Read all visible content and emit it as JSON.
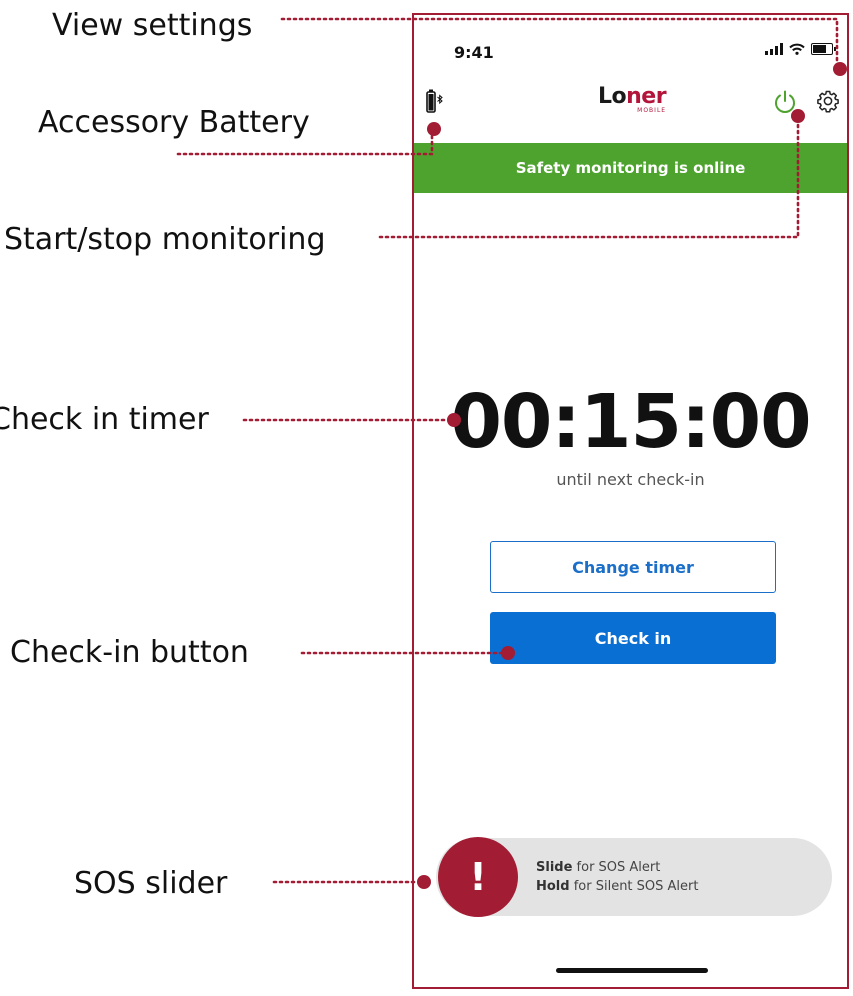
{
  "callouts": {
    "view_settings": "View settings",
    "accessory_battery": "Accessory Battery",
    "start_stop": "Start/stop monitoring",
    "check_in_timer": "Check in timer",
    "check_in_button": "Check-in button",
    "sos_slider": "SOS slider"
  },
  "status_bar": {
    "time": "9:41"
  },
  "header": {
    "logo_main": "Lo",
    "logo_accent": "ner",
    "logo_sub": "MOBILE",
    "accessory_battery_icon": "bluetooth-battery-icon",
    "power_icon": "power-icon",
    "settings_icon": "gear-icon"
  },
  "banner": {
    "text": "Safety monitoring is online"
  },
  "timer": {
    "value": "00:15:00",
    "subtitle": "until next check-in"
  },
  "buttons": {
    "change_timer": "Change timer",
    "check_in": "Check in"
  },
  "sos": {
    "knob_glyph": "!",
    "line1_bold": "Slide",
    "line1_rest": " for SOS Alert",
    "line2_bold": "Hold",
    "line2_rest": " for Silent SOS Alert"
  },
  "colors": {
    "accent_red": "#a21c34",
    "banner_green": "#4ea32e",
    "primary_blue": "#0a6fd3",
    "power_green": "#4ea32e"
  }
}
